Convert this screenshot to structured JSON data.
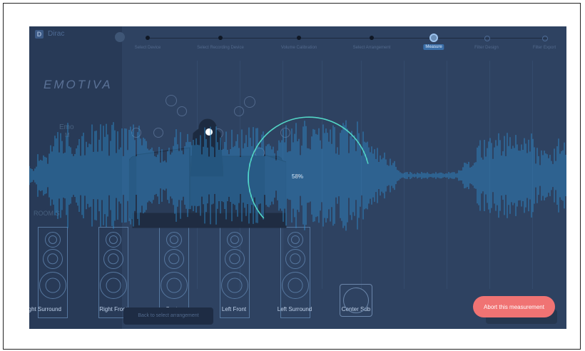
{
  "app": {
    "name": "Dirac"
  },
  "sidebar": {
    "brand": "EMOTIVA",
    "line1": "Emo",
    "line2": "M",
    "section": "ROOM S"
  },
  "steps": [
    {
      "label": "Select Device",
      "state": "done"
    },
    {
      "label": "Select Recording Device",
      "state": "done"
    },
    {
      "label": "Volume Calibration",
      "state": "done"
    },
    {
      "label": "Select Arrangement",
      "state": "done"
    },
    {
      "label": "Measure",
      "state": "current"
    },
    {
      "label": "Filter Design",
      "state": "future"
    },
    {
      "label": "Filter Export",
      "state": "future"
    }
  ],
  "progress": {
    "percent": 58,
    "text": "58%"
  },
  "speakers": [
    {
      "name": "Right Surround"
    },
    {
      "name": "Right Front"
    },
    {
      "name": "Center"
    },
    {
      "name": "Left Front"
    },
    {
      "name": "Left Surround"
    },
    {
      "name": "Center Sub"
    }
  ],
  "buttons": {
    "abort": "Abort this measurement",
    "back": "Back to select arrangement"
  },
  "colors": {
    "background": "#2e4261",
    "waveform": "#2f8fd1",
    "progress_ring": "#53d6c6",
    "abort": "#f07373"
  }
}
